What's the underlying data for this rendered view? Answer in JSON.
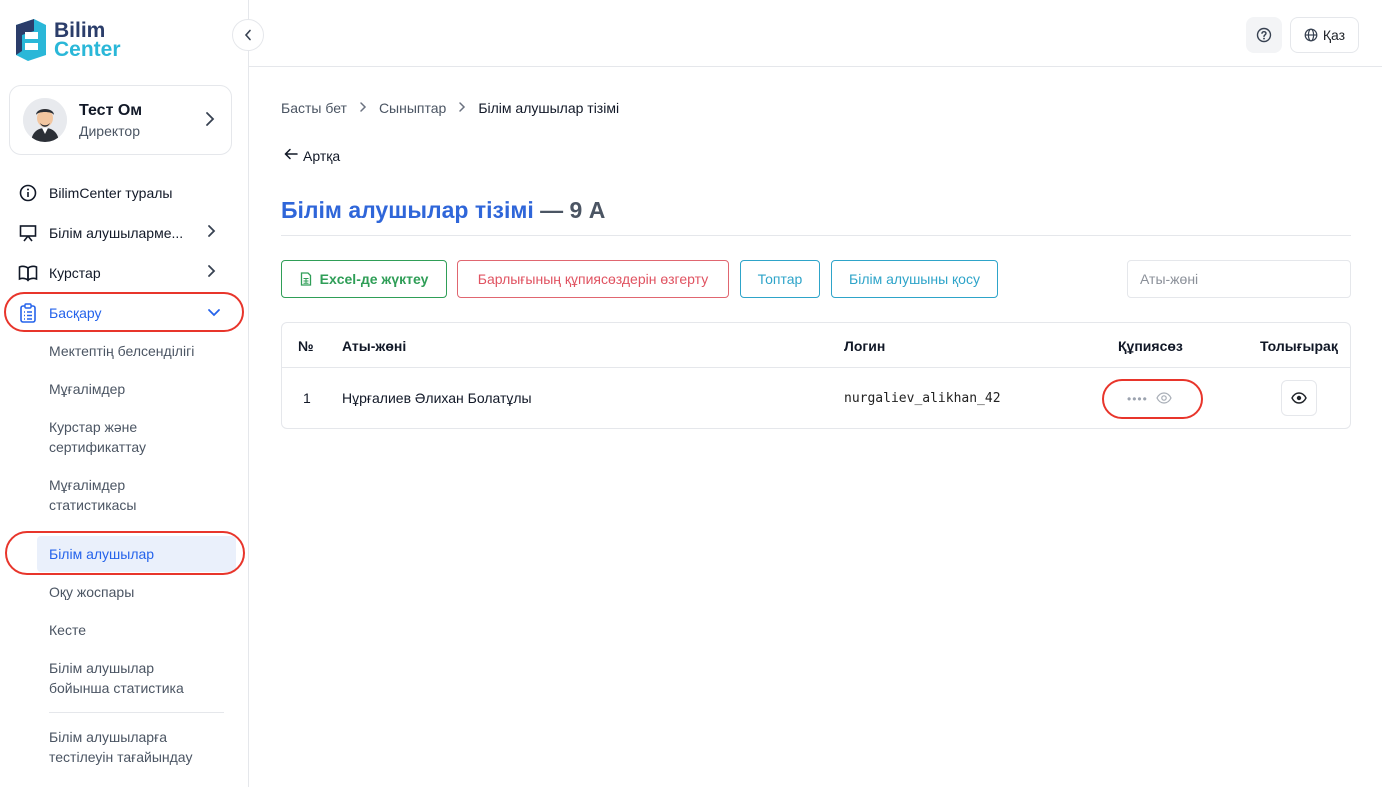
{
  "brand": {
    "line1": "Bilim",
    "line2": "Center"
  },
  "profile": {
    "name": "Тест Ом",
    "role": "Директор"
  },
  "nav": [
    {
      "label": "BilimCenter туралы",
      "icon": "info-icon"
    },
    {
      "label": "Білім алушыларме...",
      "icon": "presentation-icon"
    },
    {
      "label": "Курстар",
      "icon": "book-icon"
    },
    {
      "label": "Басқару",
      "icon": "clipboard-icon"
    }
  ],
  "subnav": [
    "Мектептің белсенділігі",
    "Мұғалімдер",
    "Курстар және сертификаттау",
    "Мұғалімдер статистикасы",
    "Білім алушылар",
    "Оқу жоспары",
    "Кесте",
    "Білім алушылар бойынша статистика",
    "Білім алушыларға тестілеуін тағайындау"
  ],
  "topbar": {
    "language": "Қаз"
  },
  "breadcrumb": [
    "Басты бет",
    "Сыныптар",
    "Білім алушылар тізімі"
  ],
  "back_label": "Артқа",
  "title": {
    "main": "Білім алушылар тізімі",
    "suffix": "— 9 А"
  },
  "actions": {
    "excel": "Excel-де жүктеу",
    "reset_passwords": "Барлығының құпиясөздерін өзгерту",
    "groups": "Топтар",
    "add_student": "Білім алушыны қосу"
  },
  "search": {
    "placeholder": "Аты-жөні"
  },
  "table": {
    "columns": [
      "№",
      "Аты-жөні",
      "Логин",
      "Құпиясөз",
      "Толығырақ"
    ],
    "rows": [
      {
        "num": "1",
        "name": "Нұрғалиев Әлихан Болатұлы",
        "login": "nurgaliev_alikhan_42",
        "password_mask": "••••"
      }
    ]
  },
  "colors": {
    "accent": "#2f66d9",
    "success": "#2f9e57",
    "danger": "#e05361",
    "info": "#2ea4c9",
    "highlight": "#e8352b"
  }
}
